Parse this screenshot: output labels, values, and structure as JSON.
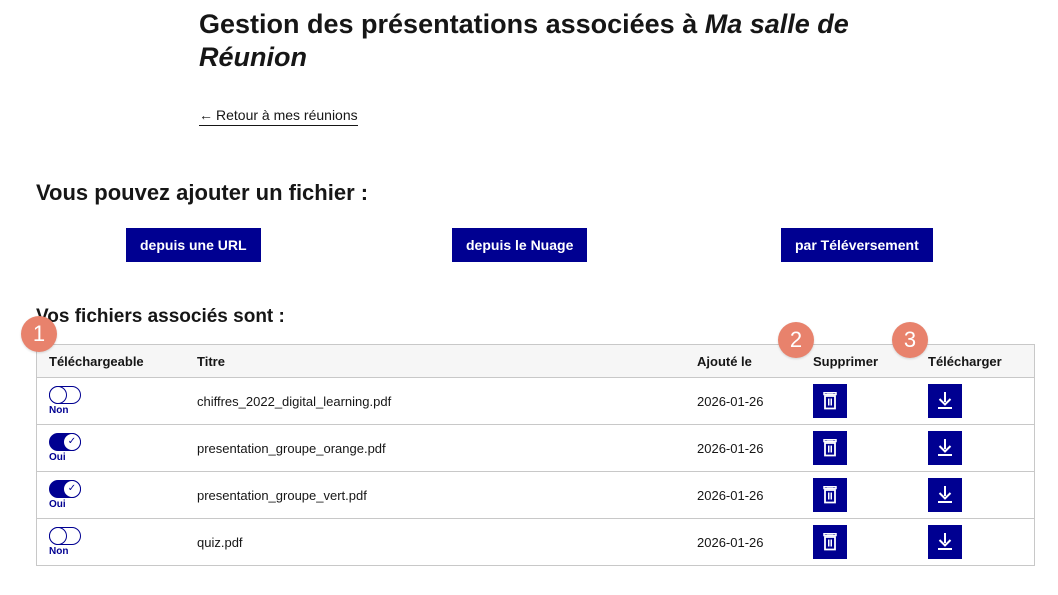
{
  "page": {
    "title_prefix": "Gestion des présentations associées à ",
    "title_room": "Ma salle de Réunion",
    "back_arrow": "←",
    "back_link": "Retour à mes réunions"
  },
  "add_section": {
    "heading": "Vous pouvez ajouter un fichier :",
    "buttons": [
      "depuis une URL",
      "depuis le Nuage",
      "par Téléversement"
    ]
  },
  "files_section": {
    "heading": "Vos fichiers associés sont :",
    "columns": [
      "Téléchargeable",
      "Titre",
      "Ajouté le",
      "Supprimer",
      "Télécharger"
    ],
    "rows": [
      {
        "downloadable": false,
        "toggle_label": "Non",
        "title": "chiffres_2022_digital_learning.pdf",
        "date": "2026-01-26"
      },
      {
        "downloadable": true,
        "toggle_label": "Oui",
        "title": "presentation_groupe_orange.pdf",
        "date": "2026-01-26"
      },
      {
        "downloadable": true,
        "toggle_label": "Oui",
        "title": "presentation_groupe_vert.pdf",
        "date": "2026-01-26"
      },
      {
        "downloadable": false,
        "toggle_label": "Non",
        "title": "quiz.pdf",
        "date": "2026-01-26"
      }
    ]
  },
  "annotations": [
    "1",
    "2",
    "3"
  ],
  "colors": {
    "primary": "#000091",
    "badge": "#e8826c",
    "border": "#c8c8c8"
  },
  "icons": {
    "delete": "trash-icon",
    "download": "download-icon",
    "check": "check-icon"
  }
}
